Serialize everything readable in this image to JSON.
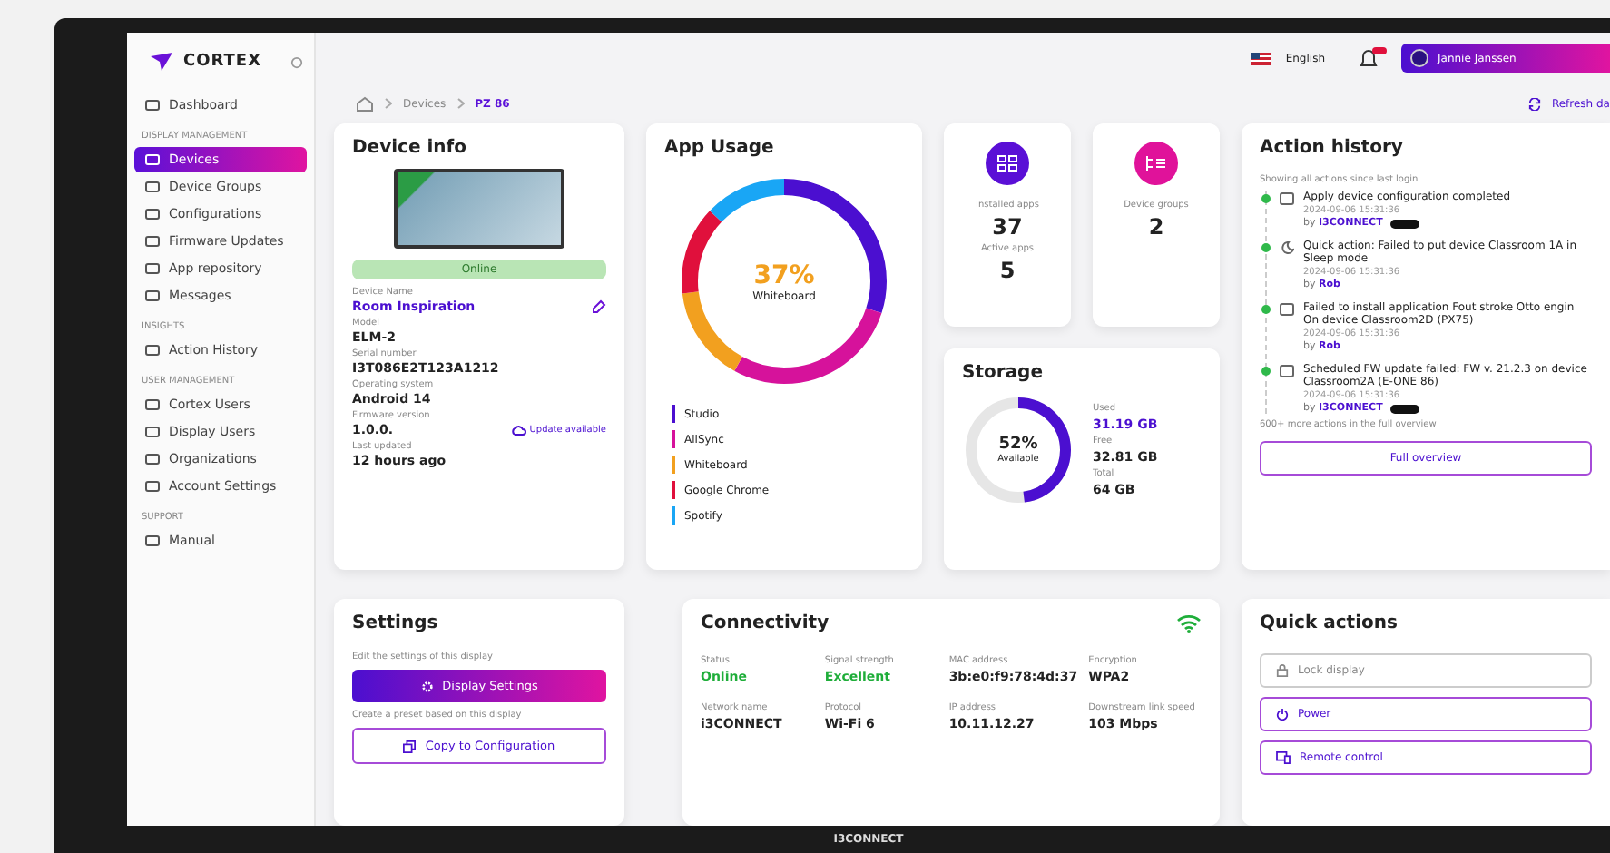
{
  "brand": {
    "name": "CORTEX"
  },
  "sidebar": {
    "items": [
      {
        "kind": "item",
        "label": "Dashboard",
        "selected": false
      },
      {
        "kind": "section",
        "label": "DISPLAY MANAGEMENT"
      },
      {
        "kind": "item",
        "label": "Devices",
        "selected": true
      },
      {
        "kind": "item",
        "label": "Device Groups",
        "selected": false
      },
      {
        "kind": "item",
        "label": "Configurations",
        "selected": false
      },
      {
        "kind": "item",
        "label": "Firmware Updates",
        "selected": false
      },
      {
        "kind": "item",
        "label": "App repository",
        "selected": false
      },
      {
        "kind": "item",
        "label": "Messages",
        "selected": false
      },
      {
        "kind": "section",
        "label": "INSIGHTS"
      },
      {
        "kind": "item",
        "label": "Action History",
        "selected": false
      },
      {
        "kind": "section",
        "label": "USER MANAGEMENT"
      },
      {
        "kind": "item",
        "label": "Cortex Users",
        "selected": false
      },
      {
        "kind": "item",
        "label": "Display Users",
        "selected": false
      },
      {
        "kind": "item",
        "label": "Organizations",
        "selected": false
      },
      {
        "kind": "item",
        "label": "Account Settings",
        "selected": false
      },
      {
        "kind": "section",
        "label": "SUPPORT"
      },
      {
        "kind": "item",
        "label": "Manual",
        "selected": false
      }
    ]
  },
  "header": {
    "language": "English",
    "user": "Jannie Janssen"
  },
  "breadcrumbs": [
    "Devices",
    "PZ 86"
  ],
  "refresh": "Refresh da",
  "device_info": {
    "title": "Device info",
    "status": "Online",
    "online": true,
    "fields": [
      {
        "label": "Device Name",
        "value": "Room Inspiration",
        "kind": "name"
      },
      {
        "label": "Model",
        "value": "ELM-2",
        "kind": "plain"
      },
      {
        "label": "Serial number",
        "value": "I3T086E2T123A1212",
        "kind": "plain"
      },
      {
        "label": "Operating system",
        "value": "Android 14",
        "kind": "plain"
      },
      {
        "label": "Firmware version",
        "value": "1.0.0.",
        "kind": "update",
        "note": "Update available"
      },
      {
        "label": "Last updated",
        "value": "12 hours ago",
        "kind": "plain"
      }
    ]
  },
  "app_usage": {
    "title": "App Usage",
    "center_value": "37%",
    "center_label": "Whiteboard",
    "apps": [
      {
        "name": "Studio",
        "color": "#4b0fd0"
      },
      {
        "name": "AllSync",
        "color": "#d6129b"
      },
      {
        "name": "Whiteboard",
        "color": "#f2a01f"
      },
      {
        "name": "Google Chrome",
        "color": "#e0103c"
      },
      {
        "name": "Spotify",
        "color": "#19a6f5"
      }
    ]
  },
  "stats": [
    {
      "color": "#5a0fd6",
      "values": [
        {
          "label": "Installed apps",
          "value": "37"
        },
        {
          "label": "Active apps",
          "value": "5"
        }
      ]
    },
    {
      "color": "#e0129a",
      "values": [
        {
          "label": "Device groups",
          "value": "2"
        }
      ]
    }
  ],
  "storage": {
    "title": "Storage",
    "percent": "52%",
    "percent_label": "Available",
    "level": 0.48,
    "rows": [
      {
        "label": "Used",
        "value": "31.19 GB",
        "kind": "used"
      },
      {
        "label": "Free",
        "value": "32.81 GB",
        "kind": "plain"
      },
      {
        "label": "Total",
        "value": "64 GB",
        "kind": "plain"
      }
    ]
  },
  "action_history": {
    "title": "Action history",
    "subtitle": "Showing all actions since last login",
    "entries": [
      {
        "text": "Apply device configuration completed",
        "time": "2024-09-06 15:31:36",
        "by": "by **I3CONNECT**",
        "tag": true
      },
      {
        "text": "Quick action: Failed to put device Classroom 1A in Sleep mode",
        "time": "2024-09-06 15:31:36",
        "by": "by **Rob**",
        "tag": false
      },
      {
        "text": "Failed to install application Fout stroke Otto engin On device Classroom2D (PX75)",
        "time": "2024-09-06 15:31:36",
        "by": "by **Rob**",
        "tag": false
      },
      {
        "text": "Scheduled FW update failed: FW v. 21.2.3 on device Classroom2A (E-ONE 86)",
        "time": "2024-09-06 15:31:36",
        "by": "by **I3CONNECT**",
        "tag": true
      }
    ],
    "more": "600+ more actions in the full overview",
    "button": "Full overview"
  },
  "settings": {
    "title": "Settings",
    "hint1": "Edit the settings of this display",
    "button1": "Display Settings",
    "hint2": "Create a preset based on this display",
    "button2": "Copy to Configuration"
  },
  "connectivity": {
    "title": "Connectivity",
    "fields": [
      {
        "label": "Status",
        "value": "Online",
        "color": "#1fae3a"
      },
      {
        "label": "Signal strength",
        "value": "Excellent",
        "color": "#1fae3a"
      },
      {
        "label": "MAC address",
        "value": "3b:e0:f9:78:4d:37",
        "color": "#222222"
      },
      {
        "label": "Encryption",
        "value": "WPA2",
        "color": "#222222"
      },
      {
        "label": "Network name",
        "value": "i3CONNECT",
        "color": "#222222"
      },
      {
        "label": "Protocol",
        "value": "Wi-Fi 6",
        "color": "#222222"
      },
      {
        "label": "IP address",
        "value": "10.11.12.27",
        "color": "#222222"
      },
      {
        "label": "Downstream link speed",
        "value": "103 Mbps",
        "color": "#222222"
      }
    ]
  },
  "quick_actions": {
    "title": "Quick actions",
    "actions": [
      {
        "label": "Lock display",
        "disabled": true
      },
      {
        "label": "Power",
        "disabled": false
      },
      {
        "label": "Remote control",
        "disabled": false
      }
    ]
  },
  "bezel_brand": "I3CONNECT"
}
